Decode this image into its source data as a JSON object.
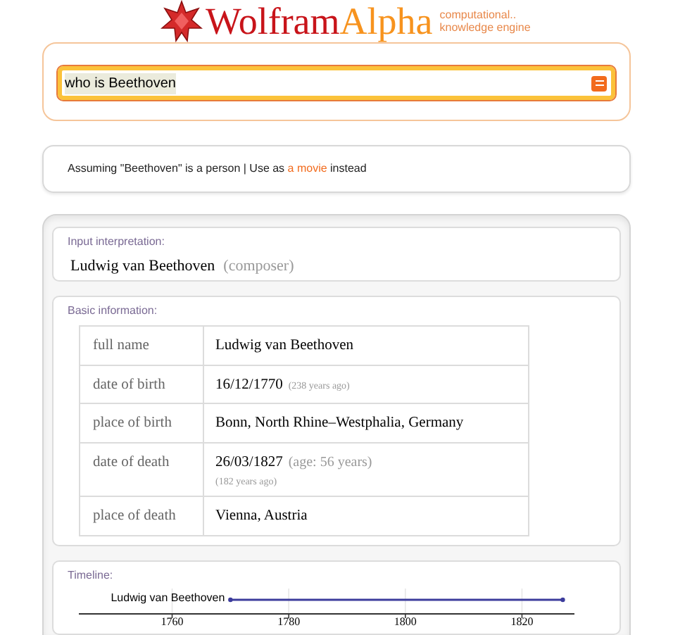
{
  "logo": {
    "word_1": "Wolfram",
    "word_2": "Alpha",
    "tagline_1": "computational..",
    "tagline_2": "knowledge engine"
  },
  "search": {
    "value": "who is Beethoven"
  },
  "assumption": {
    "text": "Assuming \"Beethoven\" is a person | Use as",
    "link": "a movie",
    "after": "instead"
  },
  "pods": [
    {
      "kind": "interpretation",
      "title": "Input interpretation:",
      "value": "Ludwig van Beethoven",
      "note": "(composer)"
    },
    {
      "kind": "table",
      "title": "Basic information:",
      "rows": [
        {
          "label": "full name",
          "value": "Ludwig van Beethoven"
        },
        {
          "label": "date of birth",
          "value": "16/12/1770",
          "note": "(238 years ago)"
        },
        {
          "label": "place of birth",
          "value": "Bonn, North Rhine–Westphalia, Germany"
        },
        {
          "label": "date of death",
          "value": "26/03/1827",
          "note": "(age: 56 years)",
          "note_2": "(182 years ago)"
        },
        {
          "label": "place of death",
          "value": "Vienna, Austria"
        }
      ]
    },
    {
      "kind": "timeline",
      "title": "Timeline:",
      "label": "Ludwig van Beethoven",
      "ticks": [
        "1760",
        "1780",
        "1800",
        "1820"
      ]
    }
  ]
}
